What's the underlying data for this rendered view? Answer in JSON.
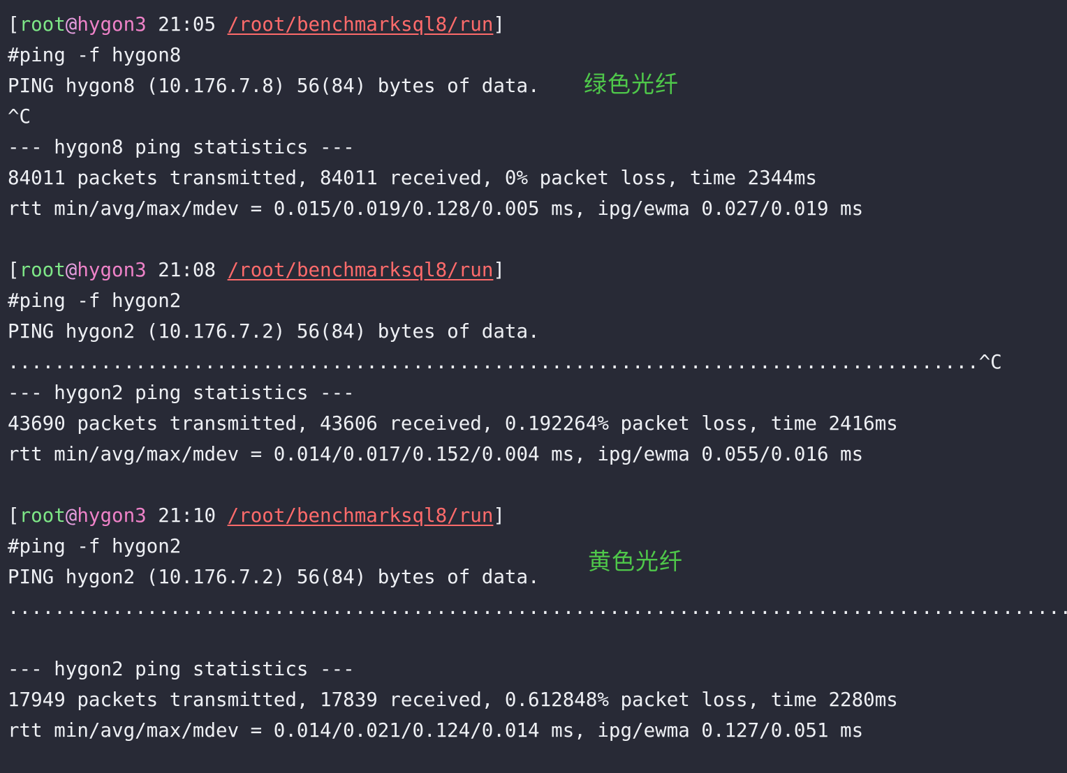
{
  "sessions": [
    {
      "prompt": {
        "open": "[",
        "user": "root",
        "at": "@",
        "host": "hygon3",
        "time": " 21:05 ",
        "path": "/root/benchmarksql8/run",
        "close": "]"
      },
      "command": "#ping -f hygon8",
      "header": "PING hygon8 (10.176.7.8) 56(84) bytes of data.",
      "progress": "^C",
      "extra_blank": false,
      "stats_title": "--- hygon8 ping statistics ---",
      "stats_packets": "84011 packets transmitted, 84011 received, 0% packet loss, time 2344ms",
      "stats_rtt": "rtt min/avg/max/mdev = 0.015/0.019/0.128/0.005 ms, ipg/ewma 0.027/0.019 ms"
    },
    {
      "prompt": {
        "open": "[",
        "user": "root",
        "at": "@",
        "host": "hygon3",
        "time": " 21:08 ",
        "path": "/root/benchmarksql8/run",
        "close": "]"
      },
      "command": "#ping -f hygon2",
      "header": "PING hygon2 (10.176.7.2) 56(84) bytes of data.",
      "progress": "....................................................................................^C",
      "extra_blank": false,
      "stats_title": "--- hygon2 ping statistics ---",
      "stats_packets": "43690 packets transmitted, 43606 received, 0.192264% packet loss, time 2416ms",
      "stats_rtt": "rtt min/avg/max/mdev = 0.014/0.017/0.152/0.004 ms, ipg/ewma 0.055/0.016 ms"
    },
    {
      "prompt": {
        "open": "[",
        "user": "root",
        "at": "@",
        "host": "hygon3",
        "time": " 21:10 ",
        "path": "/root/benchmarksql8/run",
        "close": "]"
      },
      "command": "#ping -f hygon2",
      "header": "PING hygon2 (10.176.7.2) 56(84) bytes of data.",
      "progress": "................................................................................................",
      "extra_blank": true,
      "stats_title": "--- hygon2 ping statistics ---",
      "stats_packets": "17949 packets transmitted, 17839 received, 0.612848% packet loss, time 2280ms",
      "stats_rtt": "rtt min/avg/max/mdev = 0.014/0.021/0.124/0.014 ms, ipg/ewma 0.127/0.051 ms"
    }
  ],
  "annotations": {
    "green_fiber": "绿色光纤",
    "yellow_fiber": "黄色光纤"
  },
  "colors": {
    "background": "#282a36",
    "text": "#eef0f4",
    "user": "#7ee787",
    "host": "#ee82c8",
    "path": "#ff6b6b",
    "annotation": "#4fc84a"
  }
}
